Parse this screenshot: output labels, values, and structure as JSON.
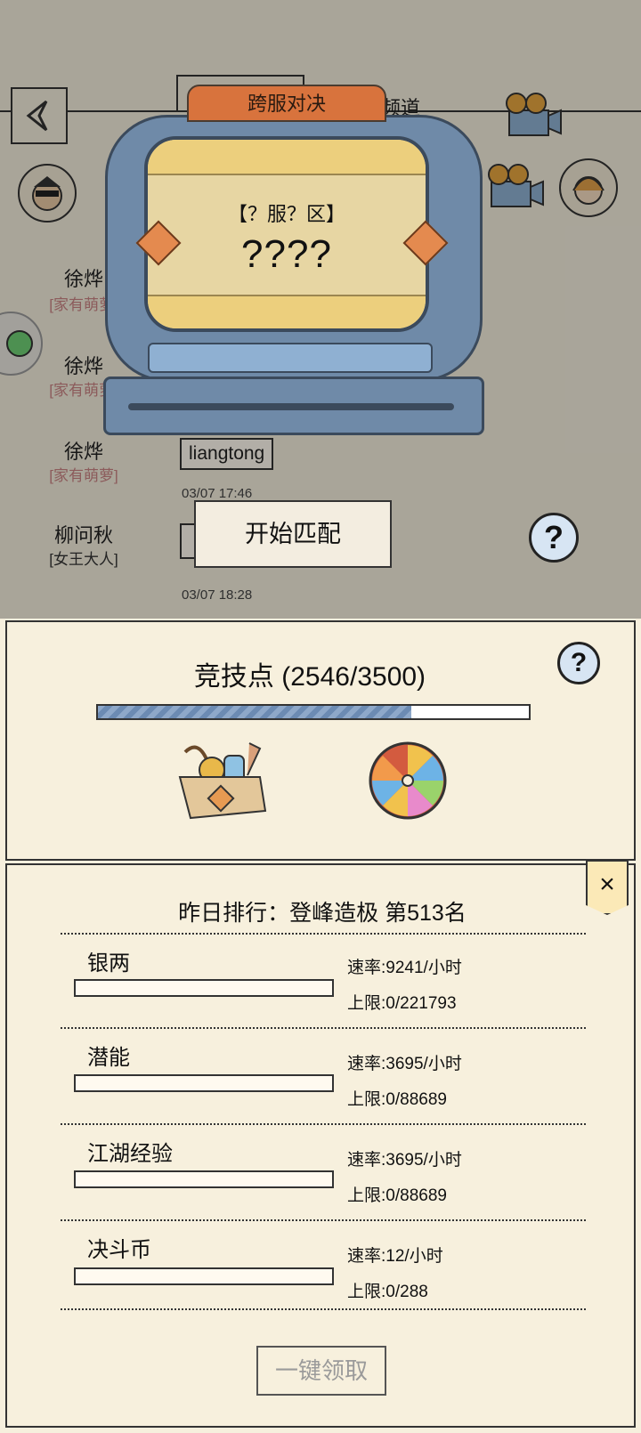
{
  "background_chat": {
    "channel_label": "频道",
    "messages": [
      {
        "name": "徐烨",
        "tag": "[家有萌萝]"
      },
      {
        "name": "徐烨",
        "tag": "[家有萌萝]"
      },
      {
        "name": "徐烨",
        "tag": "[家有萌萝]",
        "text": "liangtong",
        "time": "03/07 17:46"
      },
      {
        "name": "柳问秋",
        "tag": "[女王大人]",
        "time": "03/07 18:28"
      }
    ]
  },
  "machine": {
    "title": "跨服对决",
    "region": "【？服？区】",
    "opponent": "????"
  },
  "start_match_label": "开始匹配",
  "help_symbol": "?",
  "competitive": {
    "label": "竞技点",
    "current": 2546,
    "max": 3500,
    "display": "竞技点 (2546/3500)",
    "progress_fraction": 0.7274
  },
  "ranking": {
    "title": "昨日排行：登峰造极 第513名",
    "close_symbol": "×",
    "rows": [
      {
        "name": "银两",
        "rate": "速率:9241/小时",
        "limit": "上限:0/221793"
      },
      {
        "name": "潜能",
        "rate": "速率:3695/小时",
        "limit": "上限:0/88689"
      },
      {
        "name": "江湖经验",
        "rate": "速率:3695/小时",
        "limit": "上限:0/88689"
      },
      {
        "name": "决斗币",
        "rate": "速率:12/小时",
        "limit": "上限:0/288"
      }
    ],
    "claim_label": "一键领取"
  },
  "icons": {
    "back": "back-chevron-icon",
    "camera": "movie-camera-icon",
    "gift_box": "supply-box-icon",
    "wheel": "lucky-wheel-icon"
  }
}
